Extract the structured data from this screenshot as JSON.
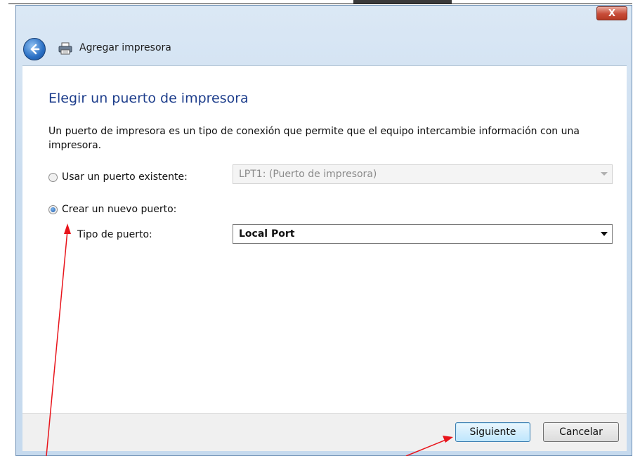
{
  "window": {
    "title": "Agregar impresora",
    "close_label": "X"
  },
  "page": {
    "heading": "Elegir un puerto de impresora",
    "description": "Un puerto de impresora es un tipo de conexión que permite que el equipo intercambie información con una impresora."
  },
  "options": {
    "existing_port": {
      "label": "Usar un puerto existente:",
      "checked": false,
      "value": "LPT1: (Puerto de impresora)",
      "enabled": false
    },
    "new_port": {
      "label": "Crear un nuevo puerto:",
      "checked": true
    },
    "port_type": {
      "label": "Tipo de puerto:",
      "value": "Local Port",
      "enabled": true
    }
  },
  "buttons": {
    "next": "Siguiente",
    "cancel": "Cancelar"
  },
  "colors": {
    "heading": "#1e3e8c",
    "annotation_arrow": "#e8141b",
    "close_button": "#c74b38"
  },
  "icons": {
    "back": "back-arrow-icon",
    "printer": "printer-icon",
    "close": "close-icon"
  }
}
